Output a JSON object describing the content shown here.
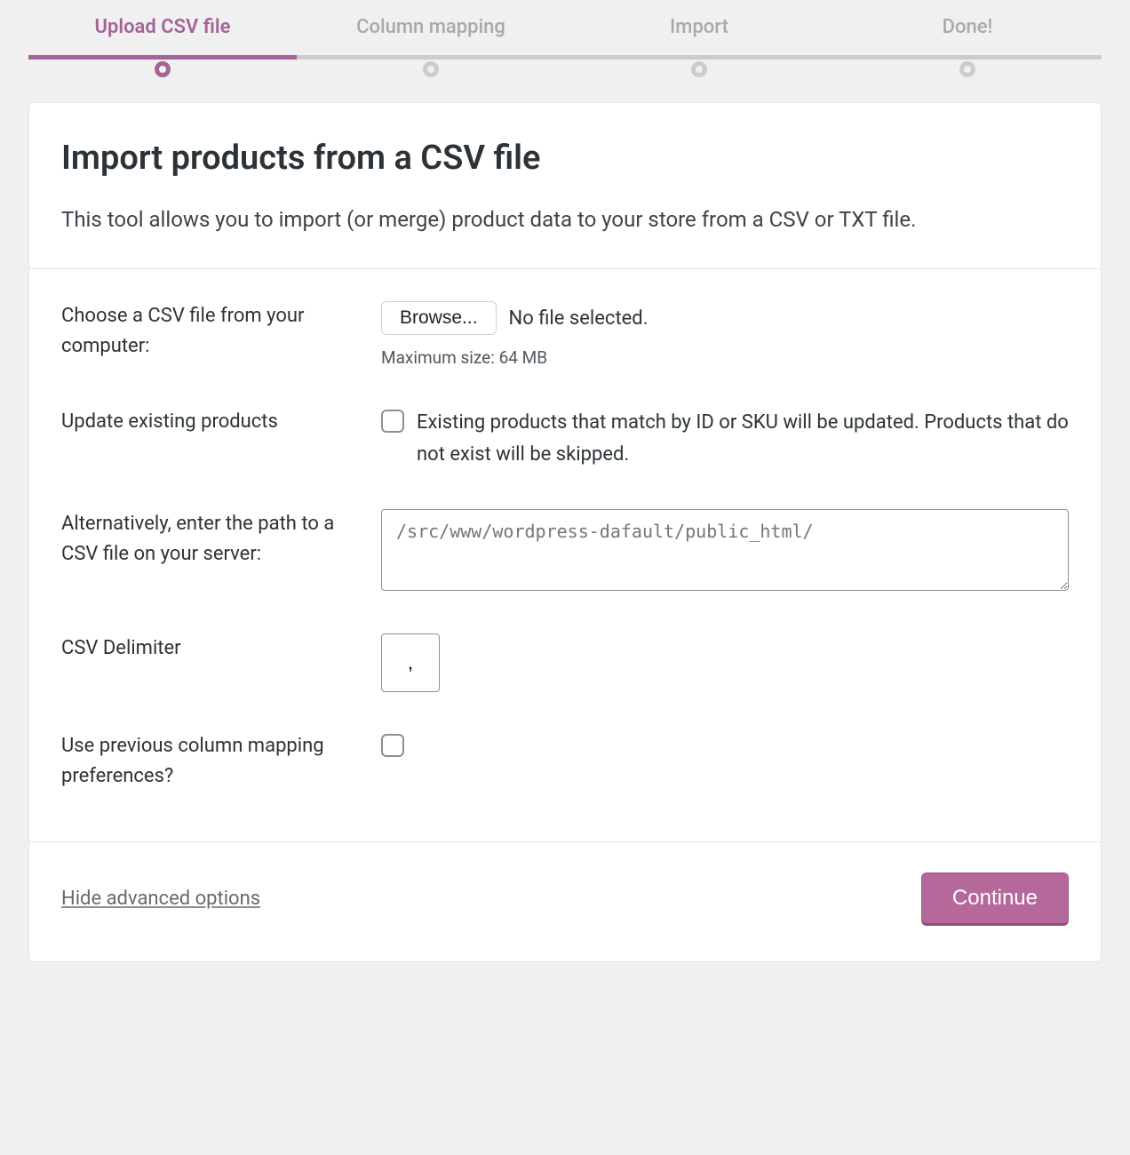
{
  "stepper": {
    "steps": [
      {
        "label": "Upload CSV file",
        "active": true
      },
      {
        "label": "Column mapping",
        "active": false
      },
      {
        "label": "Import",
        "active": false
      },
      {
        "label": "Done!",
        "active": false
      }
    ]
  },
  "header": {
    "title": "Import products from a CSV file",
    "description": "This tool allows you to import (or merge) product data to your store from a CSV or TXT file."
  },
  "form": {
    "file": {
      "label": "Choose a CSV file from your computer:",
      "browse_label": "Browse...",
      "status": "No file selected.",
      "hint": "Maximum size: 64 MB"
    },
    "update": {
      "label": "Update existing products",
      "checkbox_label": "Existing products that match by ID or SKU will be updated. Products that do not exist will be skipped."
    },
    "path": {
      "label": "Alternatively, enter the path to a CSV file on your server:",
      "placeholder": "/src/www/wordpress-dafault/public_html/"
    },
    "delimiter": {
      "label": "CSV Delimiter",
      "value": ","
    },
    "previous_mapping": {
      "label": "Use previous column mapping preferences?"
    }
  },
  "footer": {
    "toggle_link": "Hide advanced options",
    "continue_label": "Continue"
  },
  "colors": {
    "accent": "#a46497",
    "button": "#b5699b"
  }
}
